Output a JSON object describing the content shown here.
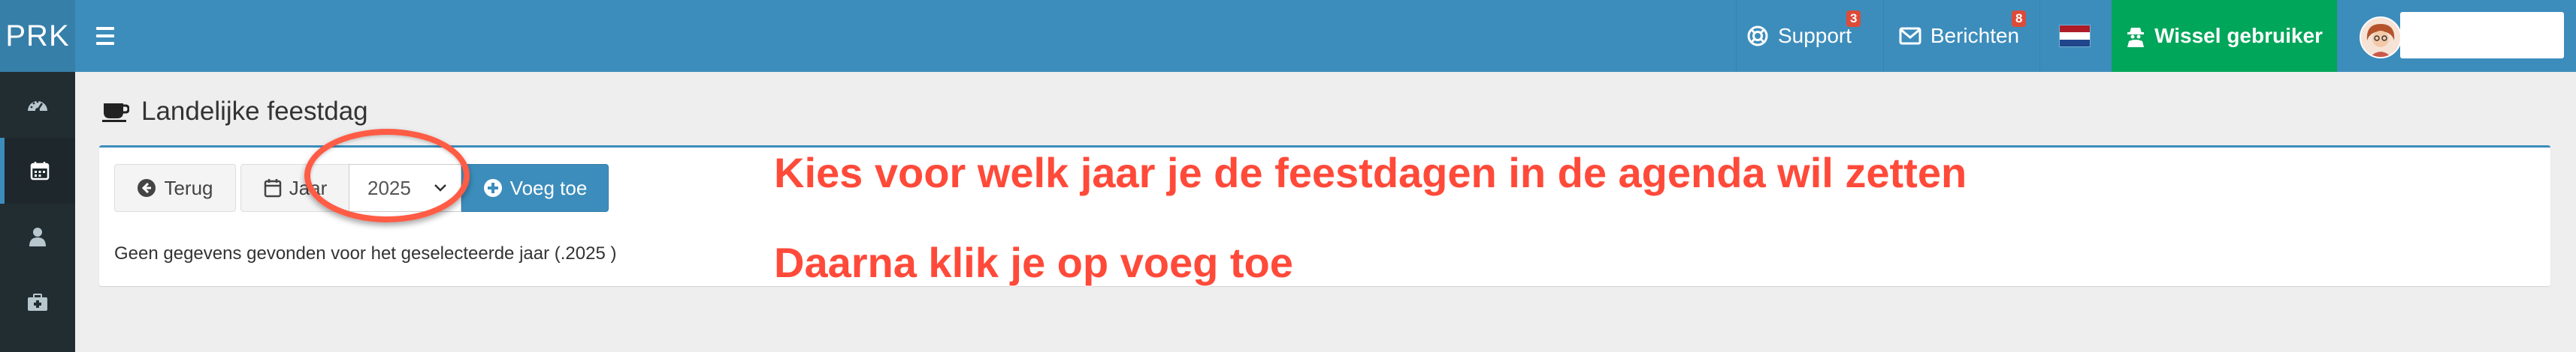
{
  "brand": {
    "logo_text": "PRK"
  },
  "topnav": {
    "support": {
      "label": "Support",
      "badge": "3",
      "icon": "life-ring-icon"
    },
    "messages": {
      "label": "Berichten",
      "badge": "8",
      "icon": "envelope-icon"
    },
    "language": {
      "icon": "dutch-flag-icon"
    },
    "switch_user": {
      "label": "Wissel gebruiker",
      "icon": "user-secret-icon"
    },
    "user": {
      "avatar_icon": "avatar"
    }
  },
  "sidebar": {
    "items": [
      {
        "icon": "dashboard-icon"
      },
      {
        "icon": "calendar-icon",
        "active": true
      },
      {
        "icon": "user-icon"
      },
      {
        "icon": "medkit-icon"
      }
    ]
  },
  "page": {
    "title": "Landelijke feestdag",
    "title_icon": "coffee-icon"
  },
  "toolbar": {
    "back_label": "Terug",
    "year_label": "Jaar",
    "year_value": "2025",
    "add_label": "Voeg toe"
  },
  "content": {
    "empty_message": "Geen gegevens gevonden voor het geselecteerde jaar (.2025 )"
  },
  "annotations": {
    "line1": "Kies voor welk jaar je de feestdagen in de agenda wil zetten",
    "line2": "Daarna klik je op voeg toe"
  },
  "colors": {
    "header": "#3c8dbc",
    "sidebar": "#222d32",
    "switch_user": "#00a65a",
    "badge": "#dd4b39",
    "annotation": "#ff4a3a"
  }
}
